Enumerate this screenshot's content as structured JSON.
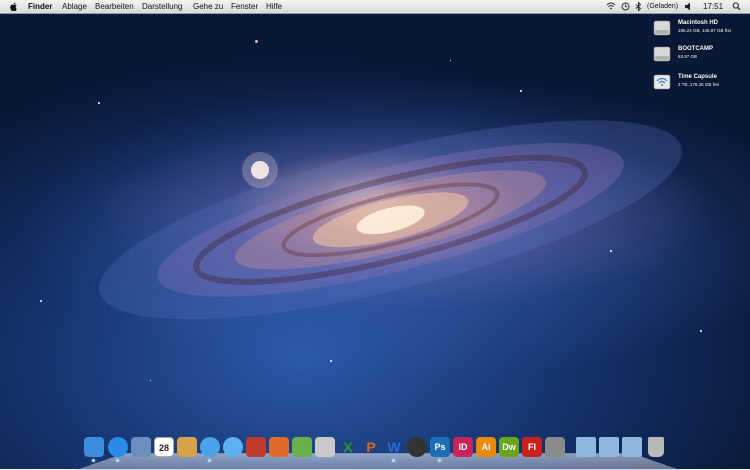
{
  "menubar": {
    "app_name": "Finder",
    "menus": [
      "Ablage",
      "Bearbeiten",
      "Darstellung",
      "Gehe zu",
      "Fenster",
      "Hilfe"
    ],
    "battery_status": "(Geladen)",
    "clock": "17:51",
    "status_icons": [
      "wifi-icon",
      "time-machine-icon",
      "bluetooth-icon",
      "volume-icon",
      "battery-icon",
      "spotlight-icon"
    ]
  },
  "desktop": {
    "drives": [
      {
        "name": "Macintosh HD",
        "info": "185.24 GB, 145.97 GB frei",
        "icon": "hard-disk-icon"
      },
      {
        "name": "BOOTCAMP",
        "info": "63.97 GB",
        "icon": "hard-disk-icon"
      },
      {
        "name": "Time Capsule",
        "info": "2 TB, 175.26 GB frei",
        "icon": "network-drive-icon"
      }
    ]
  },
  "dock": {
    "apps": [
      {
        "id": "finder",
        "icon": "finder-icon",
        "color": "#3b8be0"
      },
      {
        "id": "app-store",
        "icon": "app-store-icon",
        "color": "#2a8be8"
      },
      {
        "id": "preview",
        "icon": "preview-icon",
        "color": "#6a8ec0"
      },
      {
        "id": "ical",
        "icon": "calendar-icon",
        "color": "#ffffff",
        "text": "28"
      },
      {
        "id": "iphoto",
        "icon": "iphoto-icon",
        "color": "#d6a24a"
      },
      {
        "id": "safari",
        "icon": "safari-icon",
        "color": "#4aa3e8"
      },
      {
        "id": "itunes",
        "icon": "itunes-icon",
        "color": "#5fb0f0"
      },
      {
        "id": "photo-booth",
        "icon": "photo-booth-icon",
        "color": "#c23a2e"
      },
      {
        "id": "keynote",
        "icon": "keynote-icon",
        "color": "#e06a2a"
      },
      {
        "id": "numbers",
        "icon": "numbers-icon",
        "color": "#6ab04a"
      },
      {
        "id": "pages",
        "icon": "pages-icon",
        "color": "#c9c9c9"
      },
      {
        "id": "excel",
        "icon": "excel-icon",
        "color": "#2f9a2f",
        "text": "X"
      },
      {
        "id": "powerpoint",
        "icon": "powerpoint-icon",
        "color": "#e06a1f",
        "text": "P"
      },
      {
        "id": "word",
        "icon": "word-icon",
        "color": "#2b6fd1",
        "text": "W"
      },
      {
        "id": "crossover",
        "icon": "crossover-icon",
        "color": "#333333"
      },
      {
        "id": "photoshop",
        "icon": "photoshop-icon",
        "color": "#1d6fb5",
        "text": "Ps"
      },
      {
        "id": "indesign",
        "icon": "indesign-icon",
        "color": "#c8235a",
        "text": "ID"
      },
      {
        "id": "illustrator",
        "icon": "illustrator-icon",
        "color": "#e88a10",
        "text": "Ai"
      },
      {
        "id": "dreamweaver",
        "icon": "dreamweaver-icon",
        "color": "#6aa51f",
        "text": "Dw"
      },
      {
        "id": "flash",
        "icon": "flash-icon",
        "color": "#c8201f",
        "text": "Fl"
      },
      {
        "id": "system-preferences",
        "icon": "gear-icon",
        "color": "#8a8a8a"
      },
      {
        "id": "applications-folder",
        "icon": "folder-icon",
        "color": "#8fb8df"
      },
      {
        "id": "documents-folder",
        "icon": "folder-icon",
        "color": "#8fb8df"
      },
      {
        "id": "downloads-folder",
        "icon": "folder-icon",
        "color": "#8fb8df"
      },
      {
        "id": "trash",
        "icon": "trash-icon",
        "color": "#b8b8b8"
      }
    ]
  }
}
